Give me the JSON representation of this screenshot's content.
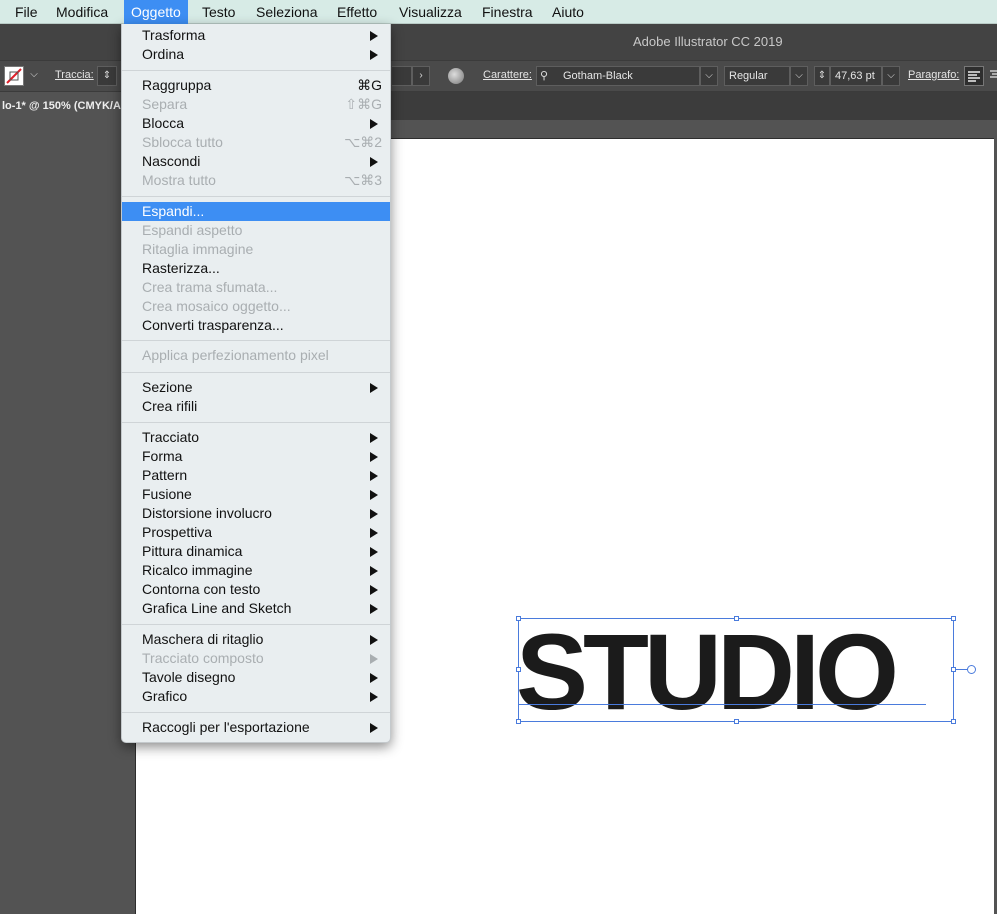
{
  "menubar": [
    "File",
    "Modifica",
    "Oggetto",
    "Testo",
    "Seleziona",
    "Effetto",
    "Visualizza",
    "Finestra",
    "Aiuto"
  ],
  "app_title": "Adobe Illustrator CC 2019",
  "controlbar": {
    "stroke_label": "Traccia:",
    "character_label": "Carattere:",
    "font_name": "Gotham-Black",
    "font_style": "Regular",
    "font_size": "47,63 pt",
    "paragraph_label": "Paragrafo:"
  },
  "document_tab": "lo-1* @ 150% (CMYK/Ar",
  "artboard_text": "STUDIO",
  "menu": {
    "g0": [
      {
        "label": "Trasforma",
        "shortcut": "",
        "sub": true,
        "disabled": false
      },
      {
        "label": "Ordina",
        "shortcut": "",
        "sub": true,
        "disabled": false
      }
    ],
    "g1": [
      {
        "label": "Raggruppa",
        "shortcut": "⌘G",
        "sub": false,
        "disabled": false
      },
      {
        "label": "Separa",
        "shortcut": "⇧⌘G",
        "sub": false,
        "disabled": true
      },
      {
        "label": "Blocca",
        "shortcut": "",
        "sub": true,
        "disabled": false
      },
      {
        "label": "Sblocca tutto",
        "shortcut": "⌥⌘2",
        "sub": false,
        "disabled": true
      },
      {
        "label": "Nascondi",
        "shortcut": "",
        "sub": true,
        "disabled": false
      },
      {
        "label": "Mostra tutto",
        "shortcut": "⌥⌘3",
        "sub": false,
        "disabled": true
      }
    ],
    "g2": [
      {
        "label": "Espandi...",
        "shortcut": "",
        "sub": false,
        "disabled": false,
        "highlighted": true
      },
      {
        "label": "Espandi aspetto",
        "shortcut": "",
        "sub": false,
        "disabled": true
      },
      {
        "label": "Ritaglia immagine",
        "shortcut": "",
        "sub": false,
        "disabled": true
      },
      {
        "label": "Rasterizza...",
        "shortcut": "",
        "sub": false,
        "disabled": false
      },
      {
        "label": "Crea trama sfumata...",
        "shortcut": "",
        "sub": false,
        "disabled": true
      },
      {
        "label": "Crea mosaico oggetto...",
        "shortcut": "",
        "sub": false,
        "disabled": true
      },
      {
        "label": "Converti trasparenza...",
        "shortcut": "",
        "sub": false,
        "disabled": false
      }
    ],
    "g3": [
      {
        "label": "Applica perfezionamento pixel",
        "shortcut": "",
        "sub": false,
        "disabled": true
      }
    ],
    "g4": [
      {
        "label": "Sezione",
        "shortcut": "",
        "sub": true,
        "disabled": false
      },
      {
        "label": "Crea rifili",
        "shortcut": "",
        "sub": false,
        "disabled": false
      }
    ],
    "g5": [
      {
        "label": "Tracciato",
        "shortcut": "",
        "sub": true,
        "disabled": false
      },
      {
        "label": "Forma",
        "shortcut": "",
        "sub": true,
        "disabled": false
      },
      {
        "label": "Pattern",
        "shortcut": "",
        "sub": true,
        "disabled": false
      },
      {
        "label": "Fusione",
        "shortcut": "",
        "sub": true,
        "disabled": false
      },
      {
        "label": "Distorsione involucro",
        "shortcut": "",
        "sub": true,
        "disabled": false
      },
      {
        "label": "Prospettiva",
        "shortcut": "",
        "sub": true,
        "disabled": false
      },
      {
        "label": "Pittura dinamica",
        "shortcut": "",
        "sub": true,
        "disabled": false
      },
      {
        "label": "Ricalco immagine",
        "shortcut": "",
        "sub": true,
        "disabled": false
      },
      {
        "label": "Contorna con testo",
        "shortcut": "",
        "sub": true,
        "disabled": false
      },
      {
        "label": "Grafica Line and Sketch",
        "shortcut": "",
        "sub": true,
        "disabled": false
      }
    ],
    "g6": [
      {
        "label": "Maschera di ritaglio",
        "shortcut": "",
        "sub": true,
        "disabled": false
      },
      {
        "label": "Tracciato composto",
        "shortcut": "",
        "sub": true,
        "disabled": true
      },
      {
        "label": "Tavole disegno",
        "shortcut": "",
        "sub": true,
        "disabled": false
      },
      {
        "label": "Grafico",
        "shortcut": "",
        "sub": true,
        "disabled": false
      }
    ],
    "g7": [
      {
        "label": "Raccogli per l'esportazione",
        "shortcut": "",
        "sub": true,
        "disabled": false
      }
    ]
  }
}
